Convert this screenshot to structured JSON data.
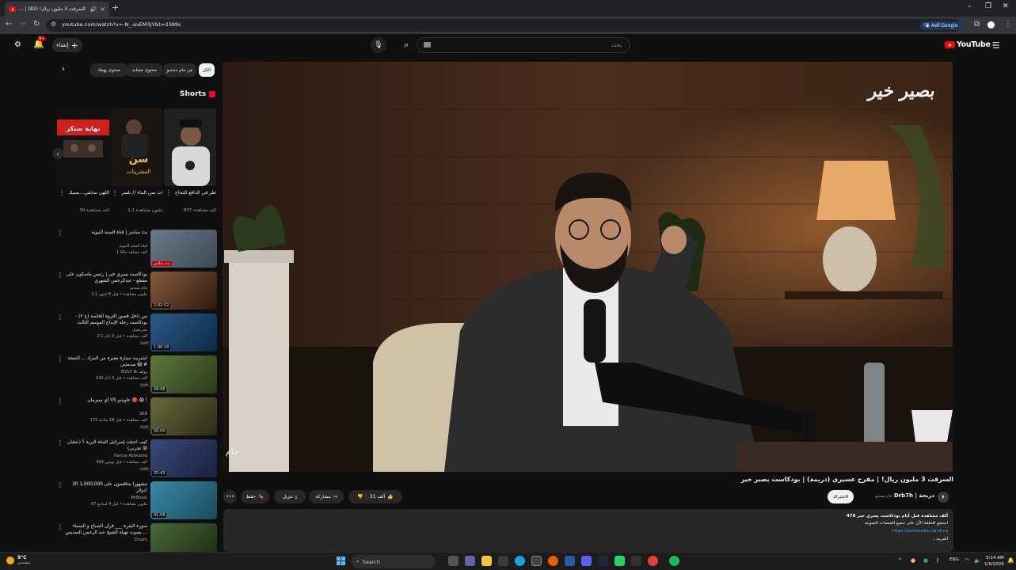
{
  "browser": {
    "tab_title": "السرقت 3 مليون ريال! (82) | ...",
    "tab_close": "×",
    "new_tab": "+",
    "url": "youtube.com/watch?v=-N_-avEM3jY&t=2389s",
    "ask_google": "Ask Google",
    "window_controls": [
      "–",
      "❐",
      "✕"
    ]
  },
  "masthead": {
    "create_label": "إنشاء",
    "notification_badge": "9+",
    "search_placeholder": "بحث",
    "logo_text": "YouTube",
    "logo_sup": "SA"
  },
  "chips": [
    "الكل",
    "من جام ستديو",
    "محتوى مشابه",
    "محتوى يهمك"
  ],
  "shorts": {
    "heading": "Shorts",
    "items": [
      {
        "title": "المخاطر في الدافع للنجاح 🇸🇦 ...",
        "views": "837 ألف مشاهدة",
        "thumb_text": "",
        "colors": [
          "#3a3a3a",
          "#1a1a1a"
        ]
      },
      {
        "title": "العشرينات سن البناء // تلسر ...",
        "views": "1.1 مليون مشاهدة",
        "thumb_text": "سن العشرينات",
        "colors": [
          "#2a2418",
          "#0d0d0d"
        ]
      },
      {
        "title": "اللهي سابقي...بسبك",
        "views": "39 ألف مشاهدة",
        "thumb_text": "نهاية سنكر",
        "colors": [
          "#1c1c1c",
          "#101010"
        ]
      }
    ]
  },
  "recommended": [
    {
      "title": "بث مباشر | قناة السنة النبوية",
      "channel": "قناة السنة النبوية",
      "meta": "1 ألف مشاهد حاليًا",
      "duration": "بث مباشر",
      "live": true,
      "new": "",
      "colors": [
        "#6a7a88",
        "#3d4a55"
      ]
    },
    {
      "title": "بودكاست يسري خير | رئيس ماسكون على مقطع - عبدالرحمن الشهري",
      "channel": "جام ستديو",
      "meta": "2.1 مليون مشاهدة • قبل 6 أشهر",
      "duration": "2:02:52",
      "live": false,
      "new": "",
      "colors": [
        "#8a5a3a",
        "#2a1a12"
      ]
    },
    {
      "title": "من داخل قصور الثروة الخاصة (ج ٢) - بودكاست رحلة الإبداع الموسم الثالث",
      "channel": "يسريعتيل",
      "meta": "2.1 ألف مشاهدة • قبل 3 أيام",
      "duration": "1:00:18",
      "live": false,
      "new": "جديد",
      "colors": [
        "#2a5a8a",
        "#0d2a44"
      ]
    },
    {
      "title": "اشتريت سيارة مغيرة من المزاد ... النتيجة صدمتني 😱 #",
      "channel": "WOLF ✪ وولف",
      "meta": "242 ألف مشاهدة • قبل 3 أيام",
      "duration": "28:08",
      "live": false,
      "new": "جديد",
      "colors": [
        "#5a7a3a",
        "#2a3a1a"
      ]
    },
    {
      "title": "آي سيرمان VS علوشو 🔴 😱 !",
      "channel": "SKB",
      "meta": "175 ألف مشاهدة • قبل 18 ساعة",
      "duration": "50:55",
      "live": false,
      "new": "جديد",
      "colors": [
        "#6a6a3a",
        "#2a2a1a"
      ]
    },
    {
      "title": "كيف احتلت إسرائيل القناة البرية ؟ (عشان تجرني) 😰",
      "channel": "Hamza Abdrazaq",
      "meta": "469 ألف مشاهدة • قبل يومين",
      "duration": "35:43",
      "live": false,
      "new": "جديد",
      "colors": [
        "#3a4a7a",
        "#1a2040"
      ]
    },
    {
      "title": "30 مشهوراً يتنافسون على 1,000,000 دولار!",
      "channel": "MrBeast",
      "meta": "47 مليون مشاهدة • قبل 4 أسابيع",
      "duration": "41:58",
      "live": false,
      "new": "",
      "colors": [
        "#3a8aaa",
        "#1a4a5a"
      ]
    },
    {
      "title": "سورة البقرة ___ قرآن الصباح و المساء بصوت تهيلة الشيخ عبد الرحمن السديس ...",
      "channel": "Emam",
      "meta": "",
      "duration": "",
      "live": false,
      "new": "",
      "colors": [
        "#4a6a3a",
        "#1a2a12"
      ]
    }
  ],
  "player": {
    "watermark": "بصير خير",
    "corner_logo": "جام"
  },
  "video": {
    "title": "السرقت 3 مليون ريال! | مفرح عسيري (دريمة) | بودكاست بصير خير",
    "like_count": "31 ألف",
    "share_label": "مشاركة",
    "download_label": "تنزيل",
    "save_label": "حفظ",
    "more_label": "•••",
    "subscribe_label": "الاشتراك",
    "channel_name": "Drb7h | دربحة",
    "channel_subs": "جام ستديو",
    "avatar_glyph": "⏵",
    "desc_stats": "478 ألف مشاهدة  قبل أيام  بودكاست  يسري خير",
    "desc_line1": "استمع للحلقة الآن على جميع المنصات الصوتية",
    "desc_link": "https://jamstudio.carrd.co",
    "desc_more": "...المزيد"
  },
  "taskbar": {
    "temp": "9°C",
    "weather": "مشمس",
    "search": "Search",
    "lang": "ENG",
    "time": "9:14 AM",
    "date": "1/9/2026"
  }
}
